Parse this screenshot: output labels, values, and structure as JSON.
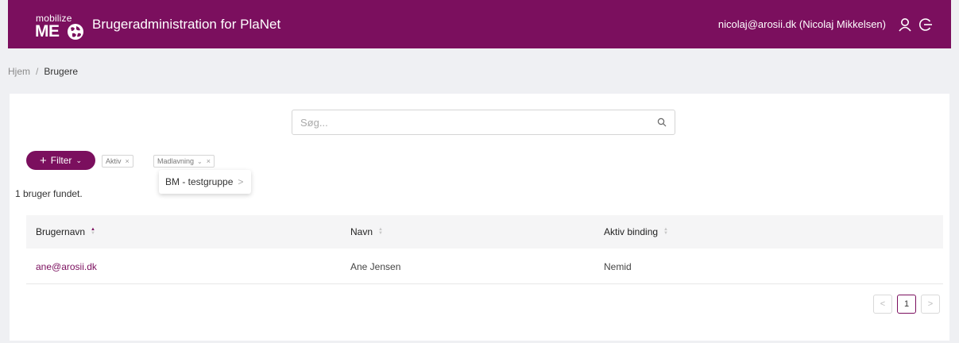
{
  "header": {
    "logo_small": "mobilize",
    "logo_big": "ME",
    "title": "Brugeradministration for PlaNet",
    "user": "nicolaj@arosii.dk (Nicolaj Mikkelsen)",
    "brand_color": "#7b0f5e"
  },
  "breadcrumb": {
    "home": "Hjem",
    "separator": "/",
    "current": "Brugere"
  },
  "search": {
    "placeholder": "Søg...",
    "value": ""
  },
  "filters": {
    "button_label": "Filter",
    "tags": [
      {
        "label": "Aktiv"
      },
      {
        "label": "Madlavning"
      }
    ],
    "dropdown_item": "BM - testgruppe"
  },
  "result_count": "1 bruger fundet.",
  "table": {
    "columns": [
      "Brugernavn",
      "Navn",
      "Aktiv binding"
    ],
    "rows": [
      {
        "username": "ane@arosii.dk",
        "name": "Ane Jensen",
        "binding": "Nemid"
      }
    ]
  },
  "pagination": {
    "current_page": "1",
    "prev": "<",
    "next": ">"
  }
}
